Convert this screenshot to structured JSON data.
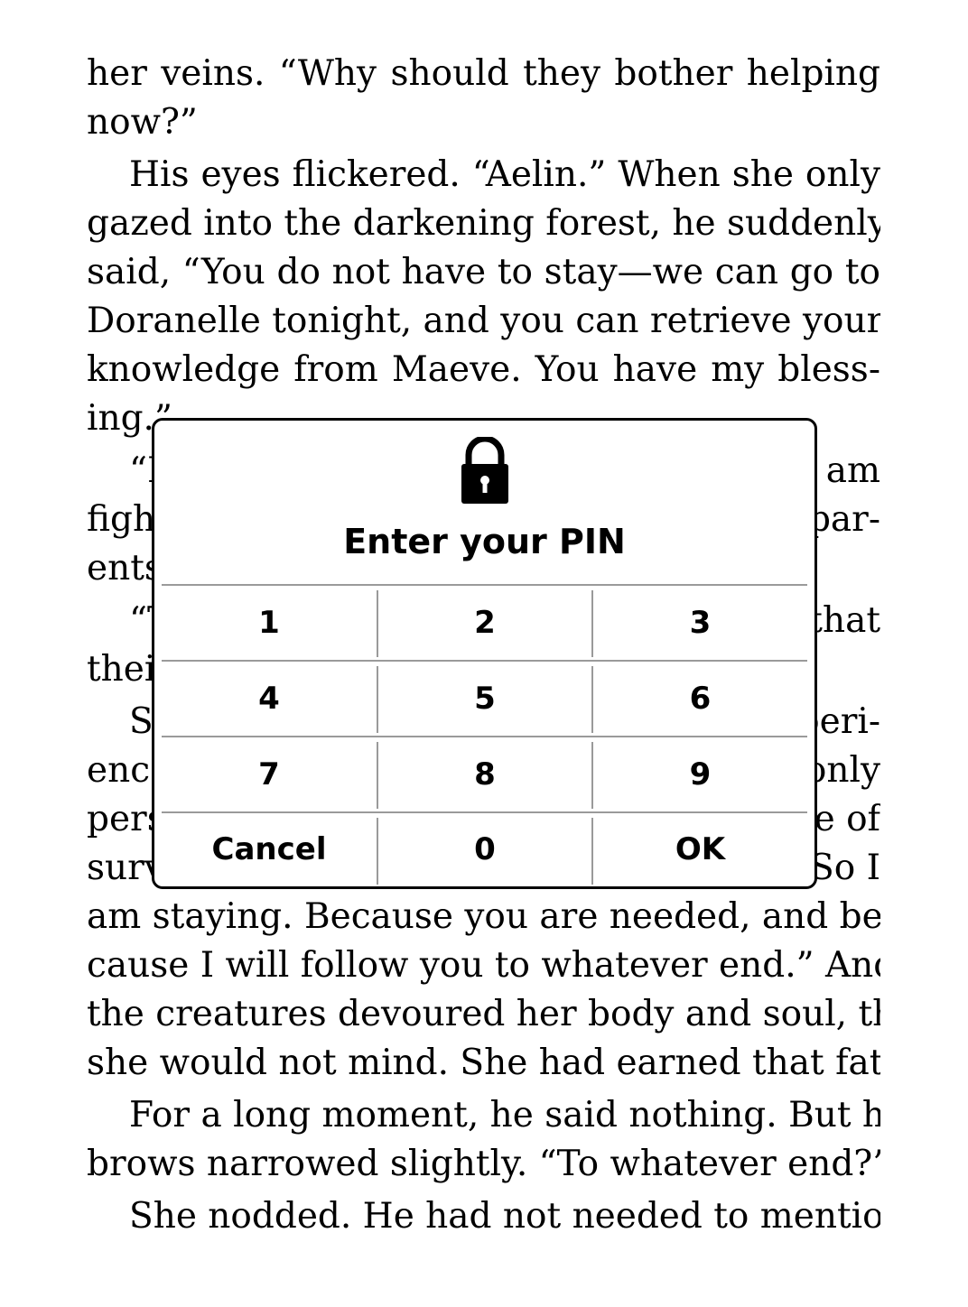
{
  "book": {
    "lines": [
      "her veins. “Why should they bother helping",
      "now?”",
      "His eyes flickered. “Aelin.” When she only",
      "gazed into the darkening forest, he suddenly",
      "said, “You do not have to stay—we can go to",
      "Doranelle tonight, and you can retrieve your",
      "knowledge from Maeve. You have my bless-",
      "ing.”",
      "“I",
      "figh",
      "ents",
      "“T",
      "thei",
      "Sh",
      "enc",
      "pers",
      "surv",
      "am staying. Because you are needed, and be-",
      "cause I will follow you to whatever end.” And if",
      "the creatures devoured her body and soul, then",
      "she would not mind. She had earned that fate.",
      "For a long moment, he said nothing. But his",
      "brows narrowed slightly. “To whatever end?”",
      "She nodded. He had not needed to mention"
    ],
    "right_fragments": [
      "I am",
      "par-",
      "that",
      "peri-",
      "only",
      "e of",
      "So I"
    ]
  },
  "pin_dialog": {
    "icon": "lock-icon",
    "title": "Enter your PIN",
    "keys": [
      "1",
      "2",
      "3",
      "4",
      "5",
      "6",
      "7",
      "8",
      "9",
      "Cancel",
      "0",
      "OK"
    ]
  }
}
